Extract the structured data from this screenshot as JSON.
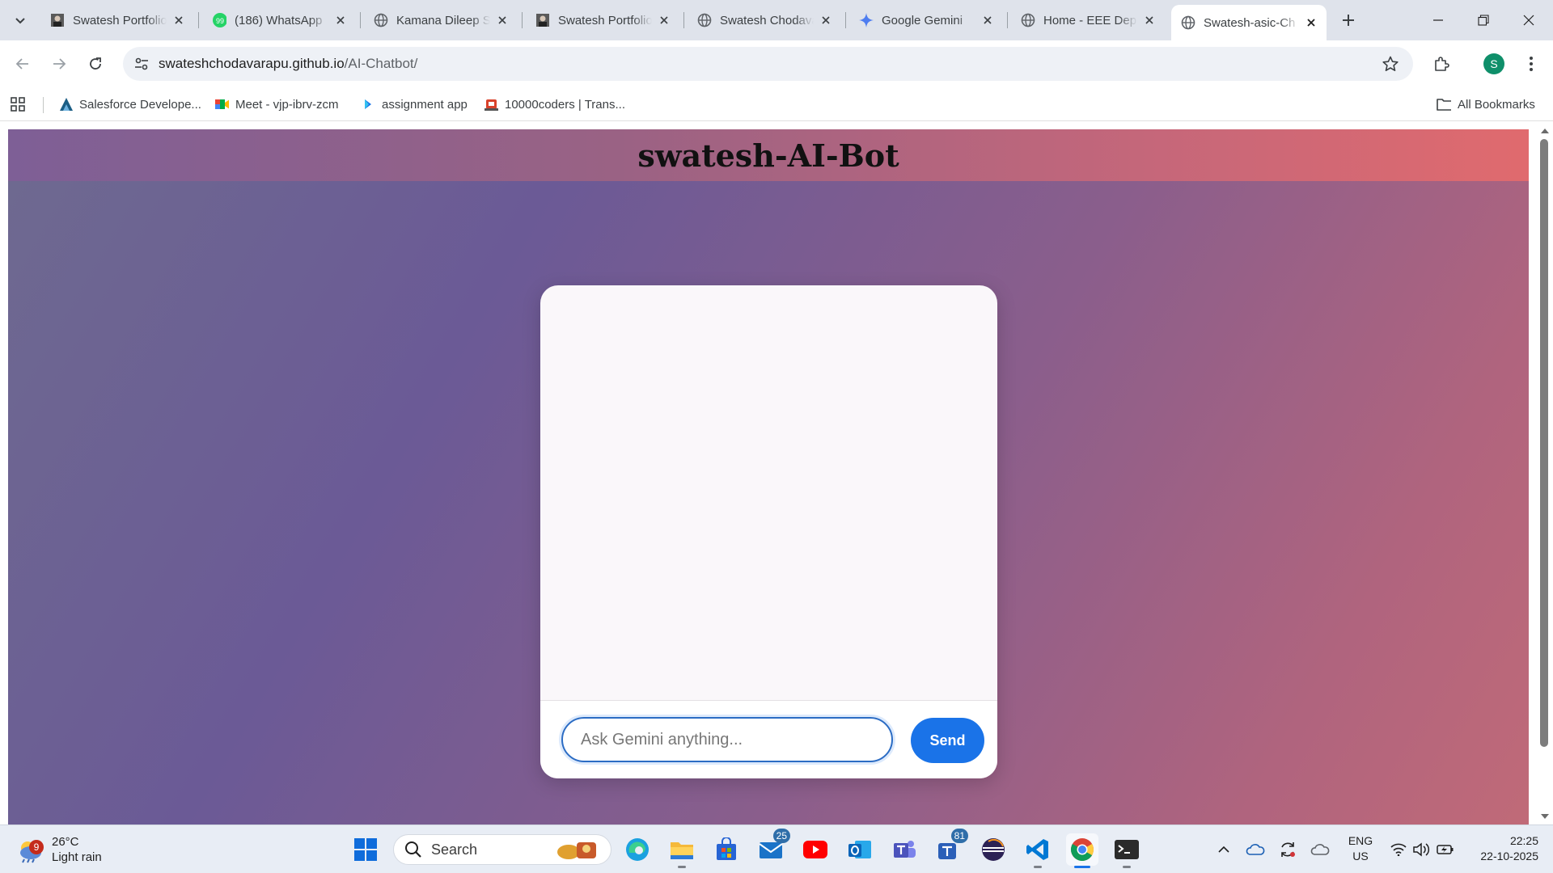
{
  "browser": {
    "tabs": [
      {
        "title": "Swatesh Portfolio",
        "icon": "portrait-favicon",
        "active": false
      },
      {
        "title": "(186) WhatsApp",
        "icon": "whatsapp-favicon",
        "badge": "99",
        "active": false
      },
      {
        "title": "Kamana Dileep S",
        "icon": "globe-favicon",
        "active": false
      },
      {
        "title": "Swatesh Portfolio",
        "icon": "portrait-favicon",
        "active": false
      },
      {
        "title": "Swatesh Chodavarapu",
        "icon": "globe-favicon",
        "active": false
      },
      {
        "title": "Google Gemini",
        "icon": "gemini-favicon",
        "active": false
      },
      {
        "title": "Home - EEE Dep",
        "icon": "globe-favicon",
        "active": false
      },
      {
        "title": "Swatesh-asic-Ch",
        "icon": "globe-favicon",
        "active": true
      }
    ],
    "address": {
      "host": "swateshchodavarapu.github.io",
      "path": "/AI-Chatbot/"
    },
    "profile_initial": "S",
    "bookmarks": [
      {
        "label": "Salesforce Develope...",
        "icon": "salesforce-icon"
      },
      {
        "label": "Meet - vjp-ibrv-zcm",
        "icon": "google-meet-icon"
      },
      {
        "label": "assignment app",
        "icon": "app-arrow-icon"
      },
      {
        "label": "10000coders | Trans...",
        "icon": "coders-icon"
      }
    ],
    "all_bookmarks_label": "All Bookmarks"
  },
  "page": {
    "title": "swatesh-AI-Bot",
    "input_placeholder": "Ask Gemini anything...",
    "send_label": "Send",
    "colors": {
      "send_button": "#1a73e8",
      "header_gradient_end": "#e06a6e",
      "header_gradient_start": "#7e5f96"
    }
  },
  "taskbar": {
    "weather": {
      "badge": "9",
      "temp": "26°C",
      "condition": "Light rain"
    },
    "search_label": "Search",
    "apps": [
      {
        "name": "edge",
        "badge": ""
      },
      {
        "name": "file-explorer",
        "badge": ""
      },
      {
        "name": "microsoft-store",
        "badge": ""
      },
      {
        "name": "mail",
        "badge": "25"
      },
      {
        "name": "youtube",
        "badge": ""
      },
      {
        "name": "outlook",
        "badge": ""
      },
      {
        "name": "teams",
        "badge": ""
      },
      {
        "name": "teams-classic",
        "badge": "81"
      },
      {
        "name": "eclipse",
        "badge": ""
      },
      {
        "name": "vscode",
        "badge": ""
      },
      {
        "name": "chrome",
        "badge": ""
      },
      {
        "name": "terminal",
        "badge": ""
      }
    ],
    "lang": "ENG",
    "region": "US",
    "time": "22:25",
    "date": "22-10-2025"
  }
}
